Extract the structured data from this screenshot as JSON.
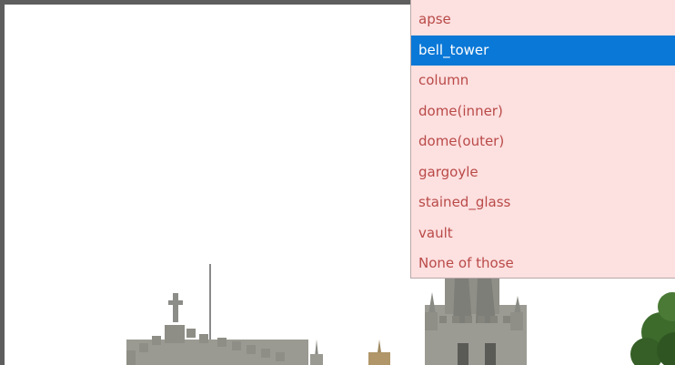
{
  "dropdown": {
    "options": [
      "apse",
      "bell_tower",
      "column",
      "dome(inner)",
      "dome(outer)",
      "gargoyle",
      "stained_glass",
      "vault",
      "None of those"
    ],
    "selected": "bell_tower",
    "colors": {
      "background": "#fde0e0",
      "text": "#b94a48",
      "highlight": "#0a78d7",
      "highlight_text": "#ffffff"
    }
  },
  "image": {
    "subject": "church-with-bell-tower"
  }
}
